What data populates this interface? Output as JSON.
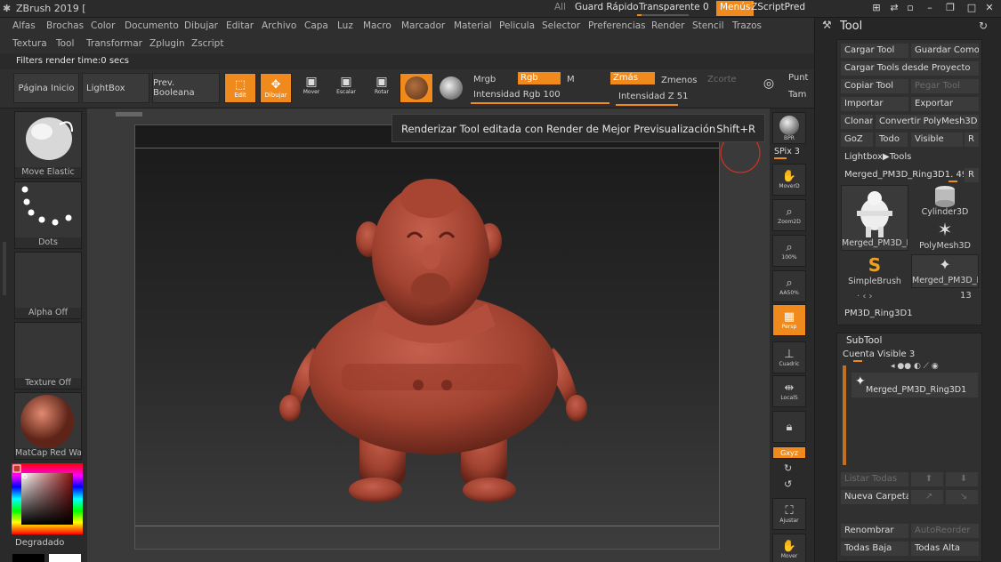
{
  "titlebar": {
    "app_title": "ZBrush 2019 [",
    "all_label": "All",
    "quicksave": "Guard Rápido",
    "transparent": "Transparente 0",
    "transparent_value": 0,
    "menus": "Menús",
    "zscript": "ZScriptPred"
  },
  "menu_row1": [
    "Alfas",
    "Brochas",
    "Color",
    "Documento",
    "Dibujar",
    "Editar",
    "Archivo",
    "Capa",
    "Luz",
    "Macro",
    "Marcador",
    "Material",
    "Pelicula",
    "Selector",
    "Preferencias",
    "Render",
    "Stencil",
    "Trazos"
  ],
  "menu_row2": [
    "Textura",
    "Tool",
    "Transformar",
    "Zplugin",
    "Zscript"
  ],
  "status": "Filters render time:0 secs",
  "toolbar": {
    "home": "Página Inicio",
    "lightbox": "LightBox",
    "prev_boolean": "Prev. Booleana",
    "edit": "Edit",
    "draw": "Dibujar",
    "move": "Mover",
    "scale": "Escalar",
    "rotate": "Rotar",
    "mrgb": "Mrgb",
    "rgb": "Rgb",
    "m": "M",
    "zadd": "Zmás",
    "zsub": "Zmenos",
    "zcut": "Zcorte",
    "rgb_intensity": "Intensidad Rgb 100",
    "rgb_intensity_value": 100,
    "z_intensity": "Intensidad Z 51",
    "z_intensity_value": 51,
    "focal": "Punt",
    "draw_size": "Tam"
  },
  "left_shelf": {
    "brush": "Move Elastic",
    "stroke": "Dots",
    "alpha": "Alpha Off",
    "texture": "Texture Off",
    "material": "MatCap Red Wa",
    "gradient": "Degradado"
  },
  "tooltip": {
    "text": "Renderizar Tool editada con Render de Mejor Previsualización",
    "shortcut": "Shift+R"
  },
  "right_shelf": {
    "bpr": "BPR",
    "spix": "SPix 3",
    "move": "MoverD",
    "zoom": "Zoom2D",
    "zoom100": "100%",
    "aahalf": "AA50%",
    "persp": "Persp",
    "floor": "Cuadric",
    "local": "LocalS",
    "lock": "",
    "xyz": "Gxyz",
    "frame": "Ajustar",
    "mover": "Mover"
  },
  "tool_panel": {
    "title": "Tool",
    "load": "Cargar Tool",
    "save_as": "Guardar Como",
    "load_project": "Cargar Tools desde Proyecto",
    "copy": "Copiar Tool",
    "paste": "Pegar Tool",
    "import": "Importar",
    "export": "Exportar",
    "clone": "Clonar",
    "convert": "Convertir PolyMesh3D",
    "goz": "GoZ",
    "all": "Todo",
    "visible": "Visible",
    "r": "R",
    "lightbox_tools": "Lightbox▶Tools",
    "current_tool": "Merged_PM3D_Ring3D1. 49",
    "current_tool_r": "R",
    "thumb1": "Merged_PM3D_I",
    "thumb2": "Cylinder3D",
    "thumb3": "PolyMesh3D",
    "thumb4": "SimpleBrush",
    "thumb5": "Merged_PM3D_F",
    "count": "13",
    "thumb6": "PM3D_Ring3D1",
    "subtool_title": "SubTool",
    "visible_count": "Cuenta Visible 3",
    "subtool_item": "Merged_PM3D_Ring3D1",
    "list_all": "Listar Todas",
    "new_folder": "Nueva Carpeta",
    "rename": "Renombrar",
    "autoreorder": "AutoReorder",
    "all_low": "Todas Baja",
    "all_high": "Todas Alta"
  },
  "colors": {
    "accent": "#f08a1c",
    "model": "#a8473a",
    "panel": "#2f2f2f"
  }
}
